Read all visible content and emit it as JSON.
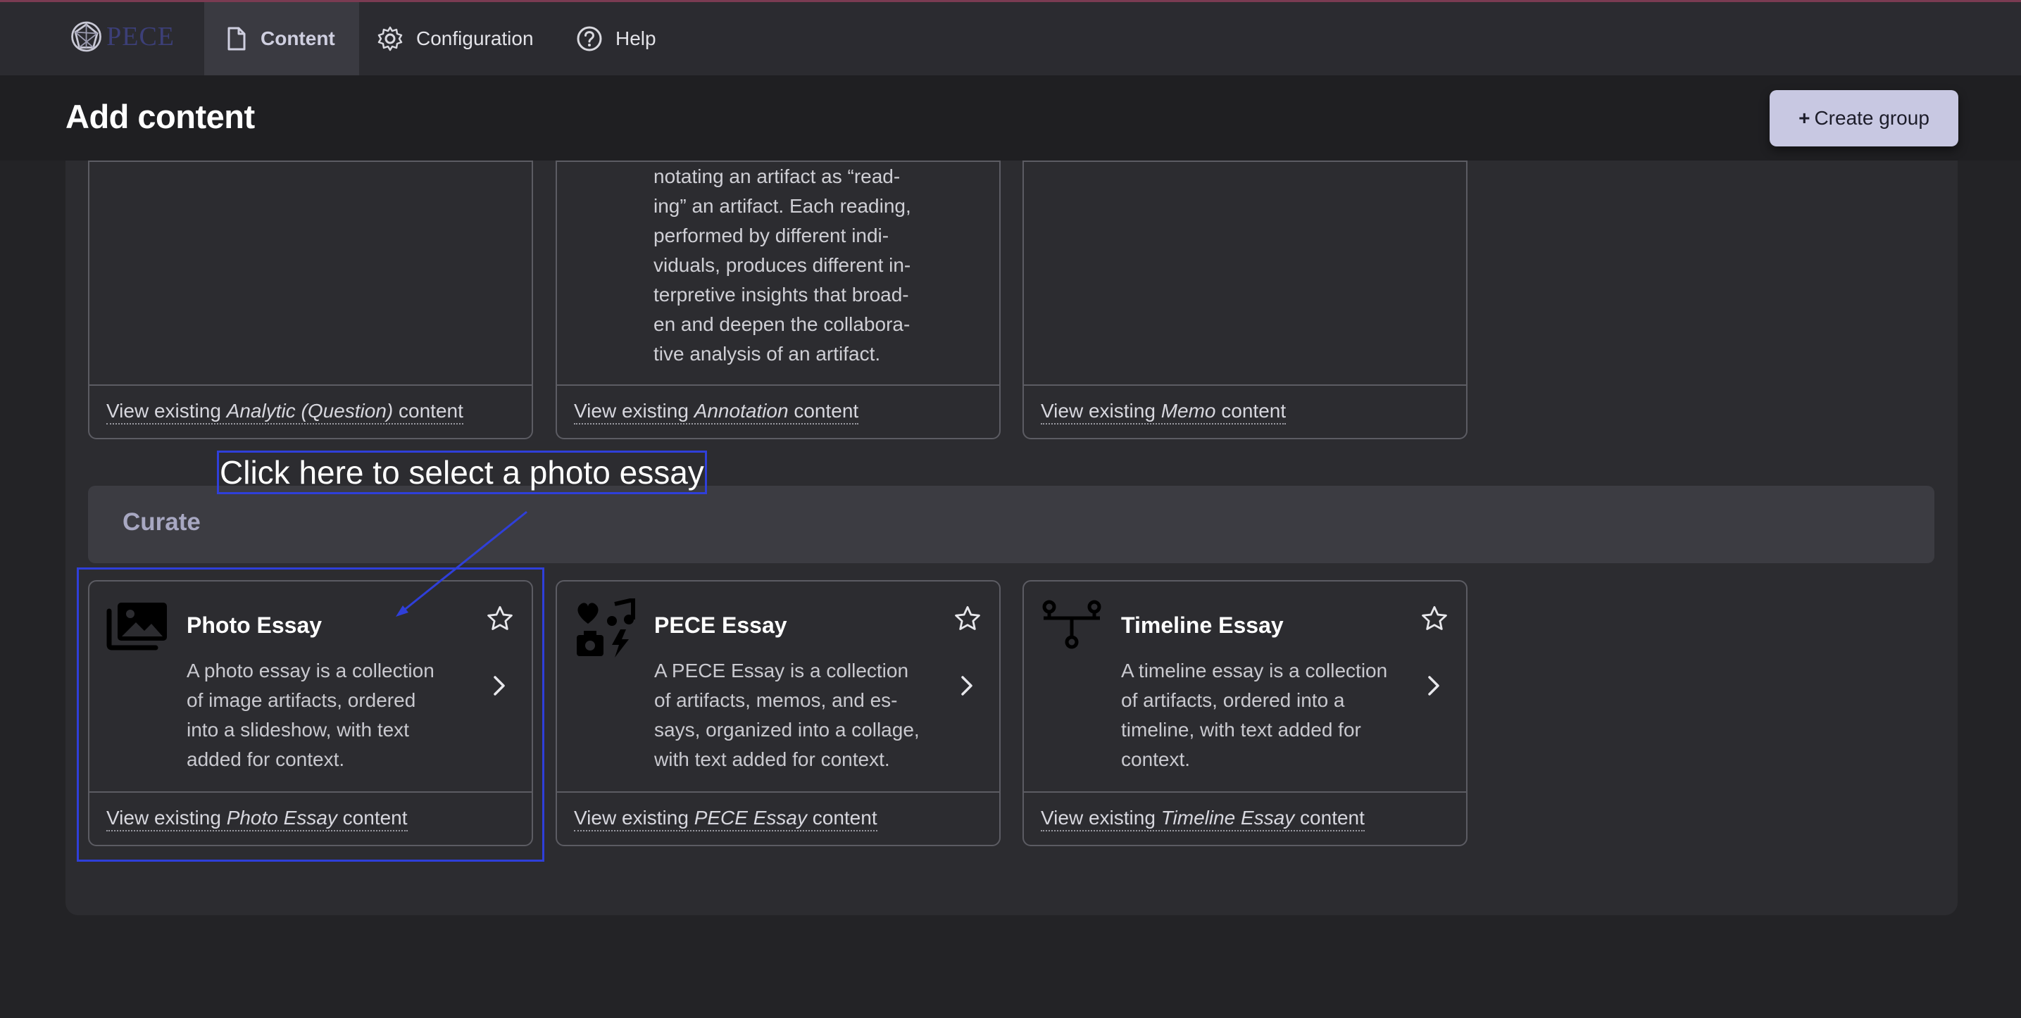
{
  "toolbar": {
    "logo_text": "PECE",
    "nav": [
      {
        "label": "Content",
        "icon": "document-icon",
        "active": true
      },
      {
        "label": "Configuration",
        "icon": "gear-icon"
      },
      {
        "label": "Help",
        "icon": "help-icon"
      }
    ]
  },
  "page": {
    "title": "Add content",
    "create_group_label": "Create group",
    "create_group_prefix": "+"
  },
  "upper_cards": [
    {
      "footer_prefix": "View existing ",
      "footer_type": "Analytic (Question)",
      "footer_suffix": " content"
    },
    {
      "description_lines": [
        "notating an artifact as “read-",
        "ing” an artifact. Each reading,",
        "performed by different indi-",
        "viduals, produces different in-",
        "terpretive insights that broad-",
        "en and deepen the collabora-",
        "tive analysis of an artifact."
      ],
      "footer_prefix": "View existing ",
      "footer_type": "Annotation",
      "footer_suffix": " content"
    },
    {
      "footer_prefix": "View existing ",
      "footer_type": "Memo",
      "footer_suffix": " content"
    }
  ],
  "tutorial": {
    "tip": "Click here to select a photo essay",
    "highlight_color": "#2f3fd9"
  },
  "curate": {
    "section_title": "Curate",
    "cards": [
      {
        "title": "Photo Essay",
        "icon": "photo-library-icon",
        "description_lines": [
          "A photo essay is a collection",
          "of image artifacts, ordered",
          "into a slideshow, with text",
          "added for context."
        ],
        "footer_prefix": "View existing ",
        "footer_type": "Photo Essay",
        "footer_suffix": " content"
      },
      {
        "title": "PECE Essay",
        "icon": "multimedia-icon",
        "description_lines": [
          "A PECE Essay is a collection",
          "of artifacts, memos, and es-",
          "says, organized into a collage,",
          "with text added for context."
        ],
        "footer_prefix": "View existing ",
        "footer_type": "PECE Essay",
        "footer_suffix": " content"
      },
      {
        "title": "Timeline Essay",
        "icon": "timeline-icon",
        "description_lines": [
          "A timeline essay is a collection",
          "of artifacts, ordered into a",
          "timeline, with text added for",
          "context."
        ],
        "footer_prefix": "View existing ",
        "footer_type": "Timeline Essay",
        "footer_suffix": " content"
      }
    ]
  },
  "colors": {
    "background": "#232326",
    "panel": "#2c2c30",
    "accent_button": "#c8c8e2",
    "curate_title": "#a8a8c2"
  }
}
